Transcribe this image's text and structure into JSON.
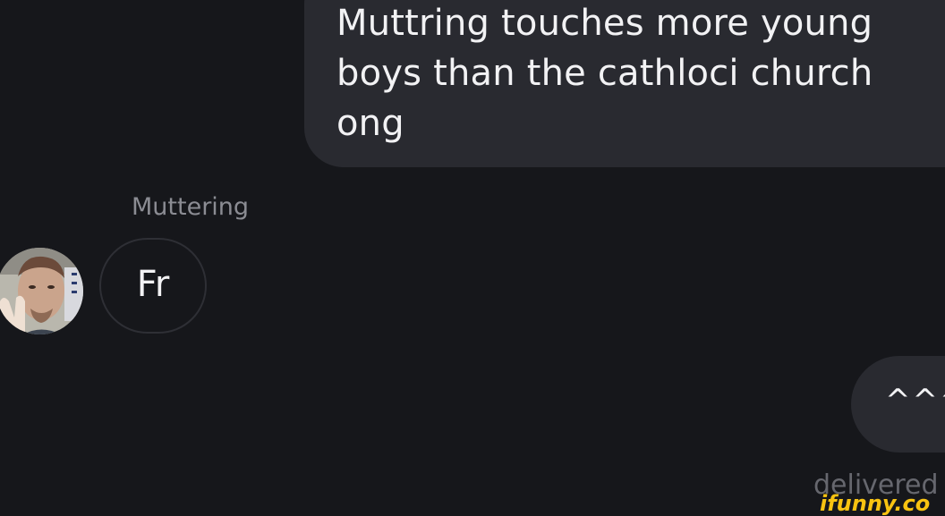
{
  "conversation": {
    "messages": [
      {
        "direction": "outgoing",
        "text": "Muttring touches more young\nboys than the cathloci church\nong"
      },
      {
        "direction": "incoming",
        "sender": "Muttering",
        "text": "Fr"
      },
      {
        "direction": "outgoing",
        "text": "^^^",
        "status": "delivered"
      }
    ]
  },
  "watermark": {
    "text": "ifunny.co",
    "color": "#f8c311"
  },
  "colors": {
    "background": "#16171b",
    "outgoing_bubble": "#292a30",
    "incoming_border": "#2e2f35",
    "message_text": "#f2f2f4",
    "muted_text": "#8b8c93"
  },
  "icons": {
    "avatar": "user-avatar-photo"
  }
}
